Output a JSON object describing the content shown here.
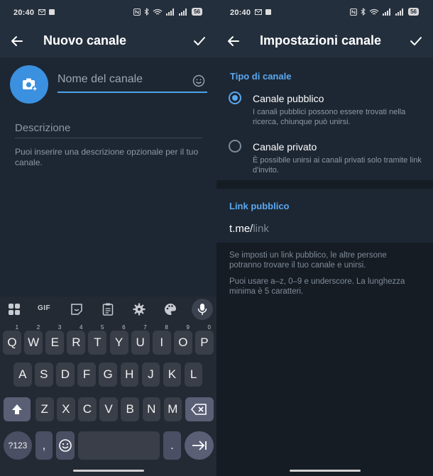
{
  "status_bar": {
    "time": "20:40",
    "battery": "56"
  },
  "left_screen": {
    "title": "Nuovo canale",
    "name_placeholder": "Nome del canale",
    "description_placeholder": "Descrizione",
    "description_hint": "Puoi inserire una descrizione opzionale per il tuo canale.",
    "keyboard": {
      "toolbar": {
        "gif_label": "GIF"
      },
      "rows": [
        [
          "Q",
          "W",
          "E",
          "R",
          "T",
          "Y",
          "U",
          "I",
          "O",
          "P"
        ],
        [
          "A",
          "S",
          "D",
          "F",
          "G",
          "H",
          "J",
          "K",
          "L"
        ],
        [
          "Z",
          "X",
          "C",
          "V",
          "B",
          "N",
          "M"
        ]
      ],
      "row1_numbers": [
        "1",
        "2",
        "3",
        "4",
        "5",
        "6",
        "7",
        "8",
        "9",
        "0"
      ],
      "symbols_key": "?123",
      "comma_key": ",",
      "period_key": "."
    }
  },
  "right_screen": {
    "title": "Impostazioni canale",
    "channel_type_title": "Tipo di canale",
    "public_option": {
      "label": "Canale pubblico",
      "description": "I canali pubblici possono essere trovati nella ricerca, chiunque può unirsi.",
      "selected": true
    },
    "private_option": {
      "label": "Canale privato",
      "description": "È possibile unirsi ai canali privati solo tramite link d'invito.",
      "selected": false
    },
    "public_link_title": "Link pubblico",
    "link_prefix": "t.me/",
    "link_placeholder": "link",
    "footer_text_1": "Se imposti un link pubblico, le altre persone potranno trovare il tuo canale e unirsi.",
    "footer_text_2": "Puoi usare a–z, 0–9 e underscore. La lunghezza minima è 5 caratteri."
  },
  "colors": {
    "accent": "#5ba8f0",
    "background": "#1d2733",
    "header": "#242f3d",
    "camera_button": "#3b91df"
  }
}
